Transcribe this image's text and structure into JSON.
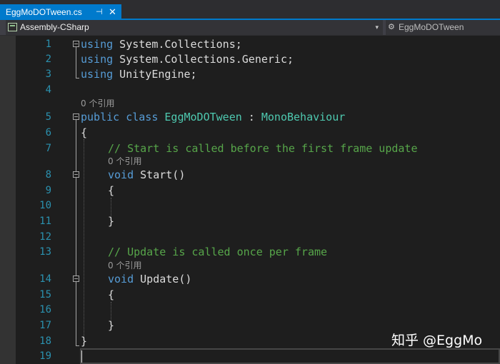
{
  "tab": {
    "title": "EggMoDOTween.cs",
    "pin_glyph": "⊣",
    "close_glyph": "✕"
  },
  "nav": {
    "project": "Assembly-CSharp",
    "dropdown_glyph": "▾",
    "class_icon": "⚙",
    "member": "EggMoDOTween"
  },
  "lines": [
    {
      "n": "1",
      "tokens": [
        [
          "kw",
          "using"
        ],
        [
          "",
          " System.Collections;"
        ]
      ]
    },
    {
      "n": "2",
      "tokens": [
        [
          "kw",
          "using"
        ],
        [
          "",
          " System.Collections.Generic;"
        ]
      ]
    },
    {
      "n": "3",
      "tokens": [
        [
          "kw",
          "using"
        ],
        [
          "",
          " UnityEngine;"
        ]
      ]
    },
    {
      "n": "4",
      "tokens": []
    },
    {
      "n": "5",
      "tokens": [
        [
          "kw",
          "public class"
        ],
        [
          "",
          " "
        ],
        [
          "ty",
          "EggMoDOTween"
        ],
        [
          "",
          " : "
        ],
        [
          "ty",
          "MonoBehaviour"
        ]
      ]
    },
    {
      "n": "6",
      "tokens": [
        [
          "",
          "{"
        ]
      ]
    },
    {
      "n": "7",
      "tokens": [
        [
          "cm",
          "// Start is called before the first frame update"
        ]
      ]
    },
    {
      "n": "8",
      "tokens": [
        [
          "kw",
          "void"
        ],
        [
          "",
          " Start()"
        ]
      ]
    },
    {
      "n": "9",
      "tokens": [
        [
          "",
          "{"
        ]
      ]
    },
    {
      "n": "10",
      "tokens": []
    },
    {
      "n": "11",
      "tokens": [
        [
          "",
          "}"
        ]
      ]
    },
    {
      "n": "12",
      "tokens": []
    },
    {
      "n": "13",
      "tokens": [
        [
          "cm",
          "// Update is called once per frame"
        ]
      ]
    },
    {
      "n": "14",
      "tokens": [
        [
          "kw",
          "void"
        ],
        [
          "",
          " Update()"
        ]
      ]
    },
    {
      "n": "15",
      "tokens": [
        [
          "",
          "{"
        ]
      ]
    },
    {
      "n": "16",
      "tokens": []
    },
    {
      "n": "17",
      "tokens": [
        [
          "",
          "}"
        ]
      ]
    },
    {
      "n": "18",
      "tokens": [
        [
          "",
          "}"
        ]
      ]
    },
    {
      "n": "19",
      "tokens": []
    }
  ],
  "ref_label": "0 个引用",
  "watermark": "知乎 @EggMo",
  "colors": {
    "accent": "#007acc",
    "keyword": "#569cd6",
    "type": "#4ec9b0",
    "comment": "#57a64a",
    "line_number": "#2b91af"
  }
}
